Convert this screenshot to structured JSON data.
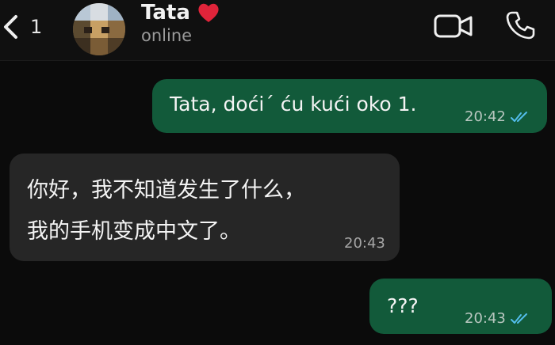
{
  "header": {
    "back_count": "1",
    "contact_name": "Tata",
    "contact_status": "online",
    "icons": {
      "back": "chevron-left-icon",
      "heart": "red-heart-icon",
      "video": "video-call-icon",
      "phone": "phone-call-icon"
    }
  },
  "messages": [
    {
      "direction": "outgoing",
      "text": "Tata, doći´ ću kući oko 1.",
      "time": "20:42",
      "status": "read"
    },
    {
      "direction": "incoming",
      "lines": [
        "你好，我不知道发生了什么，",
        "我的手机变成中文了。"
      ],
      "time": "20:43"
    },
    {
      "direction": "outgoing",
      "text": "???",
      "time": "20:43",
      "status": "read"
    }
  ],
  "colors": {
    "background": "#0b0b0b",
    "outgoing_bubble": "#125a3a",
    "incoming_bubble": "#262626",
    "read_ticks": "#53bdeb",
    "heart": "#e0243a"
  }
}
